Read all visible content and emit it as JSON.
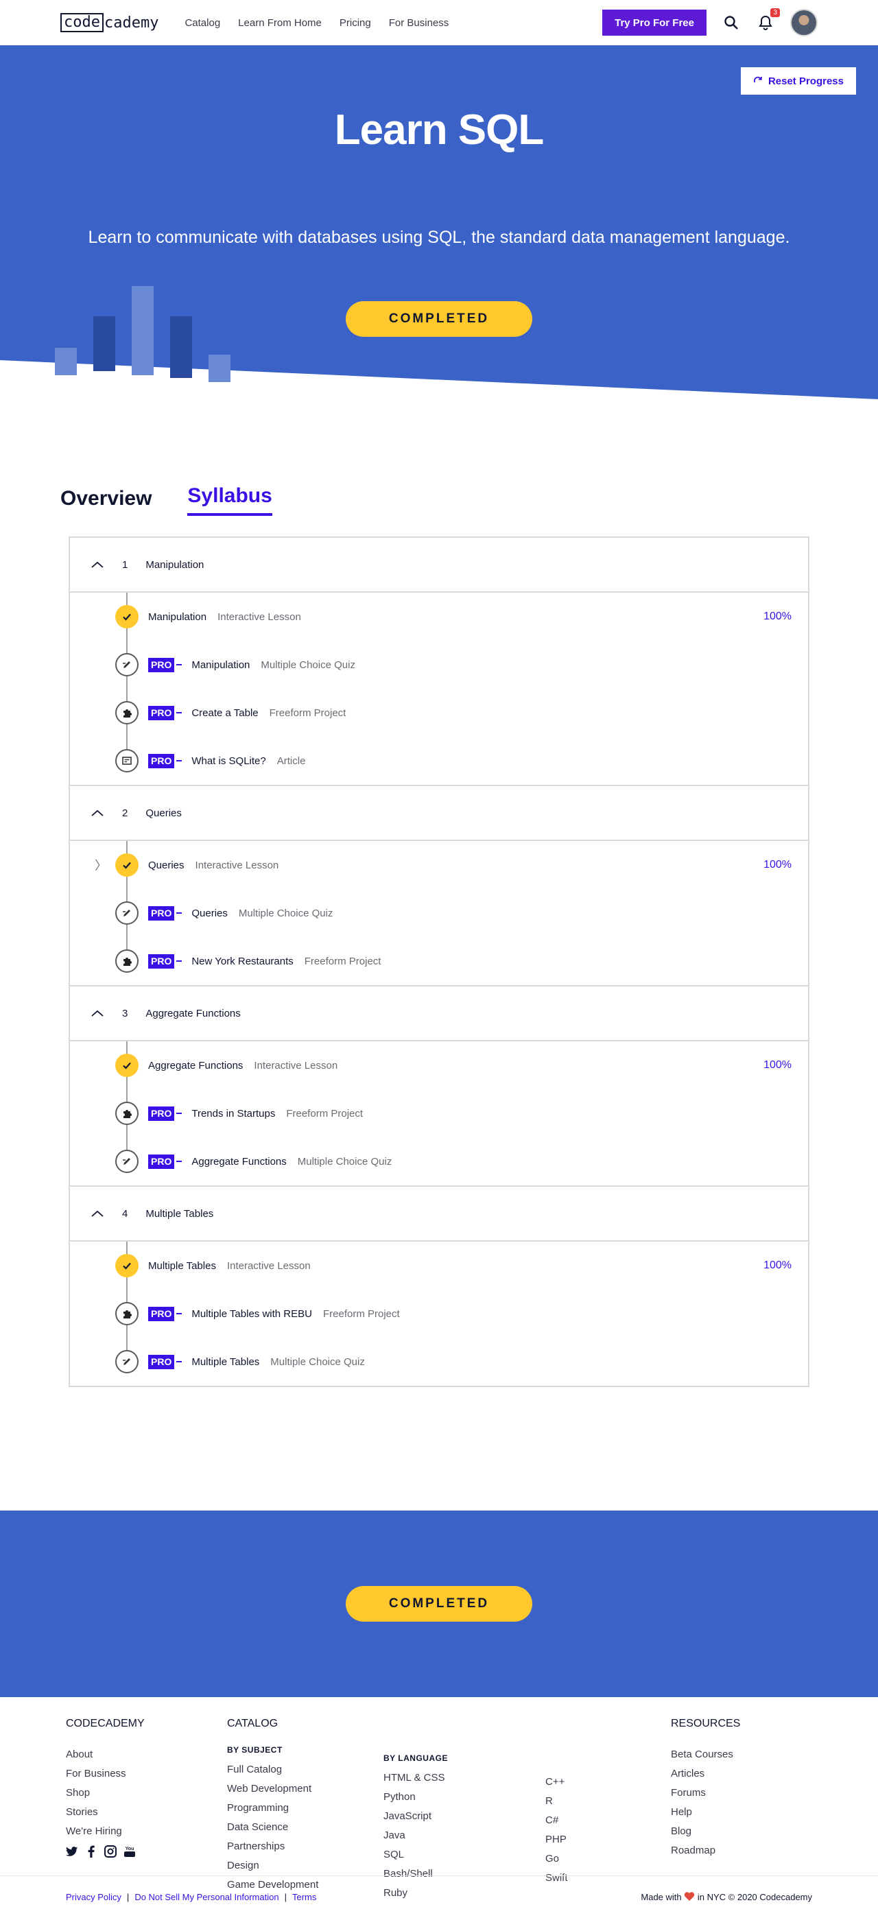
{
  "nav": {
    "logo_left": "code",
    "logo_right": "cademy",
    "links": [
      "Catalog",
      "Learn From Home",
      "Pricing",
      "For Business"
    ],
    "pro_button": "Try Pro For Free",
    "notification_count": "3"
  },
  "hero": {
    "reset_label": "Reset Progress",
    "title": "Learn SQL",
    "subtitle": "Learn to communicate with databases using SQL, the standard data management language.",
    "status": "COMPLETED"
  },
  "tabs": [
    "Overview",
    "Syllabus"
  ],
  "syllabus": [
    {
      "num": "1",
      "name": "Manipulation",
      "items": [
        {
          "title": "Manipulation",
          "type": "Interactive Lesson",
          "icon": "check-icon",
          "pro": false,
          "percent": "100%"
        },
        {
          "title": "Manipulation",
          "type": "Multiple Choice Quiz",
          "icon": "quiz-icon",
          "pro": true,
          "percent": ""
        },
        {
          "title": "Create a Table",
          "type": "Freeform Project",
          "icon": "puzzle-icon",
          "pro": true,
          "percent": ""
        },
        {
          "title": "What is SQLite?",
          "type": "Article",
          "icon": "article-icon",
          "pro": true,
          "percent": ""
        }
      ]
    },
    {
      "num": "2",
      "name": "Queries",
      "items": [
        {
          "title": "Queries",
          "type": "Interactive Lesson",
          "icon": "check-icon",
          "pro": false,
          "percent": "100%"
        },
        {
          "title": "Queries",
          "type": "Multiple Choice Quiz",
          "icon": "quiz-icon",
          "pro": true,
          "percent": ""
        },
        {
          "title": "New York Restaurants",
          "type": "Freeform Project",
          "icon": "puzzle-icon",
          "pro": true,
          "percent": ""
        }
      ]
    },
    {
      "num": "3",
      "name": "Aggregate Functions",
      "items": [
        {
          "title": "Aggregate Functions",
          "type": "Interactive Lesson",
          "icon": "check-icon",
          "pro": false,
          "percent": "100%"
        },
        {
          "title": "Trends in Startups",
          "type": "Freeform Project",
          "icon": "puzzle-icon",
          "pro": true,
          "percent": ""
        },
        {
          "title": "Aggregate Functions",
          "type": "Multiple Choice Quiz",
          "icon": "quiz-icon",
          "pro": true,
          "percent": ""
        }
      ]
    },
    {
      "num": "4",
      "name": "Multiple Tables",
      "items": [
        {
          "title": "Multiple Tables",
          "type": "Interactive Lesson",
          "icon": "check-icon",
          "pro": false,
          "percent": "100%"
        },
        {
          "title": "Multiple Tables with REBU",
          "type": "Freeform Project",
          "icon": "puzzle-icon",
          "pro": true,
          "percent": ""
        },
        {
          "title": "Multiple Tables",
          "type": "Multiple Choice Quiz",
          "icon": "quiz-icon",
          "pro": true,
          "percent": ""
        }
      ]
    }
  ],
  "pro_label": "PRO",
  "bottom_status": "COMPLETED",
  "footer": {
    "company": {
      "heading": "CODECADEMY",
      "links": [
        "About",
        "For Business",
        "Shop",
        "Stories",
        "We're Hiring"
      ]
    },
    "catalog": {
      "heading": "CATALOG",
      "by_subject": {
        "heading": "BY SUBJECT",
        "links": [
          "Full Catalog",
          "Web Development",
          "Programming",
          "Data Science",
          "Partnerships",
          "Design",
          "Game Development"
        ]
      },
      "by_language": {
        "heading": "BY LANGUAGE",
        "links": [
          "HTML & CSS",
          "Python",
          "JavaScript",
          "Java",
          "SQL",
          "Bash/Shell",
          "Ruby"
        ]
      },
      "more_languages": [
        "C++",
        "R",
        "C#",
        "PHP",
        "Go",
        "Swift"
      ]
    },
    "resources": {
      "heading": "RESOURCES",
      "links": [
        "Beta Courses",
        "Articles",
        "Forums",
        "Help",
        "Blog",
        "Roadmap"
      ]
    },
    "bottom_links": [
      "Privacy Policy",
      "Do Not Sell My Personal Information",
      "Terms"
    ],
    "made_prefix": "Made with",
    "made_suffix": "in NYC © 2020 Codecademy"
  },
  "colors": {
    "hero_blue": "#3b63c7",
    "accent_yellow": "#ffc82c",
    "pro_purple": "#3a10e5",
    "pro_button": "#5d1bd6"
  }
}
